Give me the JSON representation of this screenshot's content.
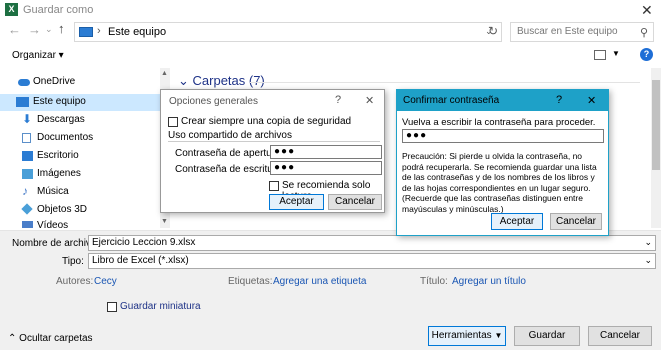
{
  "window": {
    "title": "Guardar como",
    "app_icon": "X"
  },
  "nav": {
    "path": "Este equipo",
    "search_placeholder": "Buscar en Este equipo"
  },
  "toolbar": {
    "organize": "Organizar ▾"
  },
  "sidebar": {
    "items": [
      {
        "label": "OneDrive",
        "color": "#2b7cd3"
      },
      {
        "label": "Este equipo",
        "color": "#2b7cd3"
      },
      {
        "label": "Descargas",
        "color": "#2b7cd3"
      },
      {
        "label": "Documentos",
        "color": "#5b8fc9"
      },
      {
        "label": "Escritorio",
        "color": "#2b7cd3"
      },
      {
        "label": "Imágenes",
        "color": "#4a9fd8"
      },
      {
        "label": "Música",
        "color": "#4a7ec9"
      },
      {
        "label": "Objetos 3D",
        "color": "#4a9fd8"
      },
      {
        "label": "Vídeos",
        "color": "#4a7ec9"
      }
    ]
  },
  "content": {
    "folders_header": "Carpetas (7)"
  },
  "general_options": {
    "title": "Opciones generales",
    "help": "?",
    "close": "✕",
    "backup_label": "Crear siempre una copia de seguridad",
    "sharing_label": "Uso compartido de archivos",
    "open_pwd_label": "Contraseña de apertura:",
    "open_pwd_value": "●●●",
    "write_pwd_label": "Contraseña de escritura:",
    "write_pwd_value": "●●●",
    "readonly_label": "Se recomienda solo lectura",
    "ok": "Aceptar",
    "cancel": "Cancelar"
  },
  "confirm": {
    "title": "Confirmar contraseña",
    "help": "?",
    "close": "✕",
    "prompt": "Vuelva a escribir la contraseña para proceder.",
    "value": "●●●",
    "warning": "Precaución: Si pierde u olvida la contraseña, no podrá recuperarla. Se recomienda guardar una lista de las contraseñas y de los nombres de los libros y de las hojas correspondientes en un lugar seguro. (Recuerde que las contraseñas distinguen entre mayúsculas y minúsculas.)",
    "ok": "Aceptar",
    "cancel": "Cancelar"
  },
  "save": {
    "filename_label": "Nombre de archivo:",
    "filename": "Ejercicio Leccion 9.xlsx",
    "type_label": "Tipo:",
    "type": "Libro de Excel (*.xlsx)",
    "authors_label": "Autores:",
    "authors": "Cecy",
    "tags_label": "Etiquetas:",
    "tags": "Agregar una etiqueta",
    "title_label": "Título:",
    "title_value": "Agregar un título",
    "thumbnail": "Guardar miniatura",
    "hide_folders": "Ocultar carpetas",
    "tools": "Herramientas",
    "save": "Guardar",
    "cancel": "Cancelar"
  }
}
